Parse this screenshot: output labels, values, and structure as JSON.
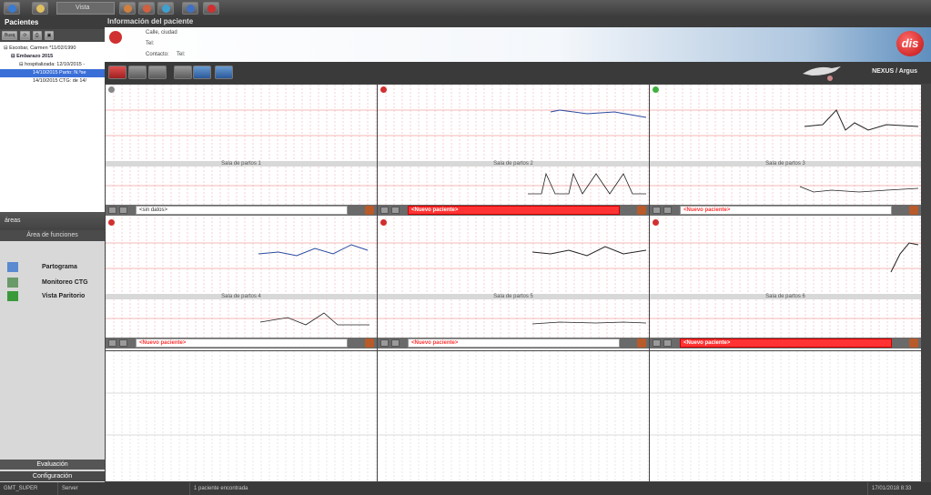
{
  "toolbar": {
    "vista_label": "Vista"
  },
  "left": {
    "title": "Pacientes",
    "tree": [
      "Escobar, Carmen *11/02/1990",
      "Embarazo 2015",
      "hospitalizada: 12/10/2015 -",
      "14/10/2015 Parto: N.ºse",
      "14/10/2015 CTG: de 14/"
    ],
    "areas_label": "áreas",
    "functions_header": "Área de funciones",
    "functions": [
      "Partograma",
      "Monitoreo CTG",
      "Vista Paritorio"
    ],
    "evaluacion": "Evaluación",
    "configuracion": "Configuración"
  },
  "patient": {
    "header": "Información del paciente",
    "street": "Calle, ciudad",
    "tel": "Tel:",
    "contacto": "Contacto:",
    "contacto_tel": "Tel:",
    "logo": "dis"
  },
  "brand": "NEXUS / Argus",
  "panels": [
    {
      "sala": "Sala de partos 1",
      "field": "<sin datos>",
      "state": "plain",
      "dot": "#888888"
    },
    {
      "sala": "Sala de partos 2",
      "field": "<Nuevo paciente>",
      "state": "red",
      "dot": "#d03030"
    },
    {
      "sala": "Sala de partos 3",
      "field": "<Nuevo paciente>",
      "state": "newtext",
      "dot": "#40b040"
    },
    {
      "sala": "Sala de partos 4",
      "field": "<Nuevo paciente>",
      "state": "newtext",
      "dot": "#d03030"
    },
    {
      "sala": "Sala de partos 5",
      "field": "<Nuevo paciente>",
      "state": "newtext",
      "dot": "#d03030"
    },
    {
      "sala": "Sala de partos 6",
      "field": "<Nuevo paciente>",
      "state": "red",
      "dot": "#d03030"
    }
  ],
  "status": {
    "user": "GMT_SUPER",
    "server": "Server",
    "found": "1 paciente encontrada",
    "datetime": "17/01/2018 8:33"
  }
}
